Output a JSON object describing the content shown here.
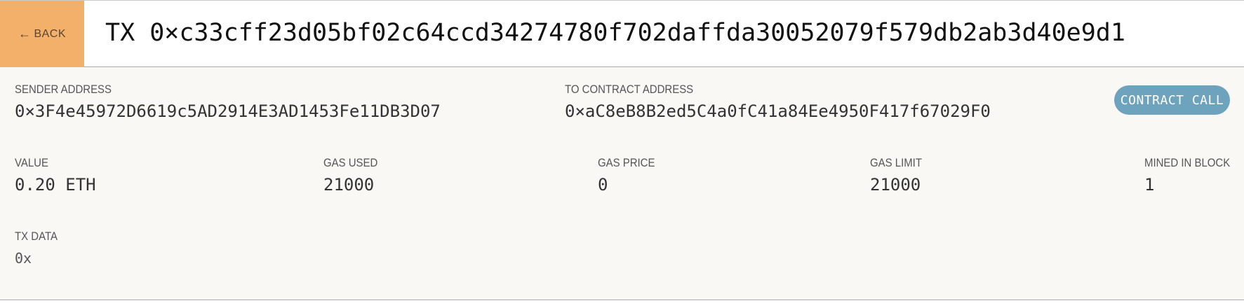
{
  "header": {
    "back_label": "BACK",
    "back_arrow": "←",
    "title": "TX 0×c33cff23d05bf02c64ccd34274780f702daffda30052079f579db2ab3d40e9d1"
  },
  "transaction": {
    "sender_label": "SENDER ADDRESS",
    "sender_value": "0×3F4e45972D6619c5AD2914E3AD1453Fe11DB3D07",
    "to_label": "TO CONTRACT ADDRESS",
    "to_value": "0×aC8eB8B2ed5C4a0fC41a84Ee4950F417f67029F0",
    "type_badge": "CONTRACT CALL",
    "value_label": "VALUE",
    "value_value": "0.20 ETH",
    "gas_used_label": "GAS USED",
    "gas_used_value": "21000",
    "gas_price_label": "GAS PRICE",
    "gas_price_value": "0",
    "gas_limit_label": "GAS LIMIT",
    "gas_limit_value": "21000",
    "block_label": "MINED IN BLOCK",
    "block_value": "1",
    "data_label": "TX DATA",
    "data_value": "0x"
  },
  "colors": {
    "back_button_bg": "#f3b06a",
    "badge_bg": "#6ea3bd",
    "detail_bg": "#f9f8f4"
  }
}
